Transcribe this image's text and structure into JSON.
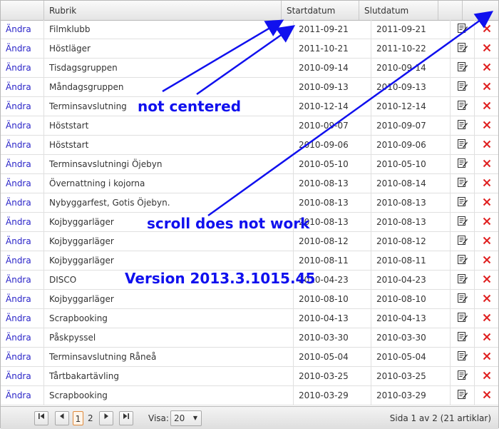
{
  "columns": [
    "",
    "Rubrik",
    "Startdatum",
    "Slutdatum",
    "",
    ""
  ],
  "rows": [
    {
      "action": "Ändra",
      "rubrik": "Filmklubb",
      "start": "2011-09-21",
      "end": "2011-09-21"
    },
    {
      "action": "Ändra",
      "rubrik": "Höstläger",
      "start": "2011-10-21",
      "end": "2011-10-22"
    },
    {
      "action": "Ändra",
      "rubrik": "Tisdagsgruppen",
      "start": "2010-09-14",
      "end": "2010-09-14"
    },
    {
      "action": "Ändra",
      "rubrik": "Måndagsgruppen",
      "start": "2010-09-13",
      "end": "2010-09-13"
    },
    {
      "action": "Ändra",
      "rubrik": "Terminsavslutning",
      "start": "2010-12-14",
      "end": "2010-12-14"
    },
    {
      "action": "Ändra",
      "rubrik": "Höststart",
      "start": "2010-09-07",
      "end": "2010-09-07"
    },
    {
      "action": "Ändra",
      "rubrik": "Höststart",
      "start": "2010-09-06",
      "end": "2010-09-06"
    },
    {
      "action": "Ändra",
      "rubrik": "Terminsavslutningi Öjebyn",
      "start": "2010-05-10",
      "end": "2010-05-10"
    },
    {
      "action": "Ändra",
      "rubrik": "Övernattning i kojorna",
      "start": "2010-08-13",
      "end": "2010-08-14"
    },
    {
      "action": "Ändra",
      "rubrik": "Nybyggarfest, Gotis Öjebyn.",
      "start": "2010-08-13",
      "end": "2010-08-13"
    },
    {
      "action": "Ändra",
      "rubrik": "Kojbyggarläger",
      "start": "2010-08-13",
      "end": "2010-08-13"
    },
    {
      "action": "Ändra",
      "rubrik": "Kojbyggarläger",
      "start": "2010-08-12",
      "end": "2010-08-12"
    },
    {
      "action": "Ändra",
      "rubrik": "Kojbyggarläger",
      "start": "2010-08-11",
      "end": "2010-08-11"
    },
    {
      "action": "Ändra",
      "rubrik": "DISCO",
      "start": "2010-04-23",
      "end": "2010-04-23"
    },
    {
      "action": "Ändra",
      "rubrik": "Kojbyggarläger",
      "start": "2010-08-10",
      "end": "2010-08-10"
    },
    {
      "action": "Ändra",
      "rubrik": "Scrapbooking",
      "start": "2010-04-13",
      "end": "2010-04-13"
    },
    {
      "action": "Ändra",
      "rubrik": "Påskpyssel",
      "start": "2010-03-30",
      "end": "2010-03-30"
    },
    {
      "action": "Ändra",
      "rubrik": "Terminsavslutning Råneå",
      "start": "2010-05-04",
      "end": "2010-05-04"
    },
    {
      "action": "Ändra",
      "rubrik": "Tårtbakartävling",
      "start": "2010-03-25",
      "end": "2010-03-25"
    },
    {
      "action": "Ändra",
      "rubrik": "Scrapbooking",
      "start": "2010-03-29",
      "end": "2010-03-29"
    }
  ],
  "row_icons": {
    "edit": "edit-icon",
    "delete": "delete-icon"
  },
  "pager": {
    "first_icon": "first-page-icon",
    "prev_icon": "prev-page-icon",
    "next_icon": "next-page-icon",
    "last_icon": "last-page-icon",
    "pages": [
      "1",
      "2"
    ],
    "current_page": "1",
    "visa_label": "Visa:",
    "page_size": "20",
    "info": "Sida 1 av 2 (21 artiklar)"
  },
  "annotations": {
    "not_centered": "not centered",
    "scroll": "scroll does not work",
    "version": "Version 2013.3.1015.45"
  },
  "colors": {
    "link": "#2a24c8",
    "annotation": "#1010ee",
    "delete": "#e02020",
    "pager_current": "#e08a3c"
  }
}
